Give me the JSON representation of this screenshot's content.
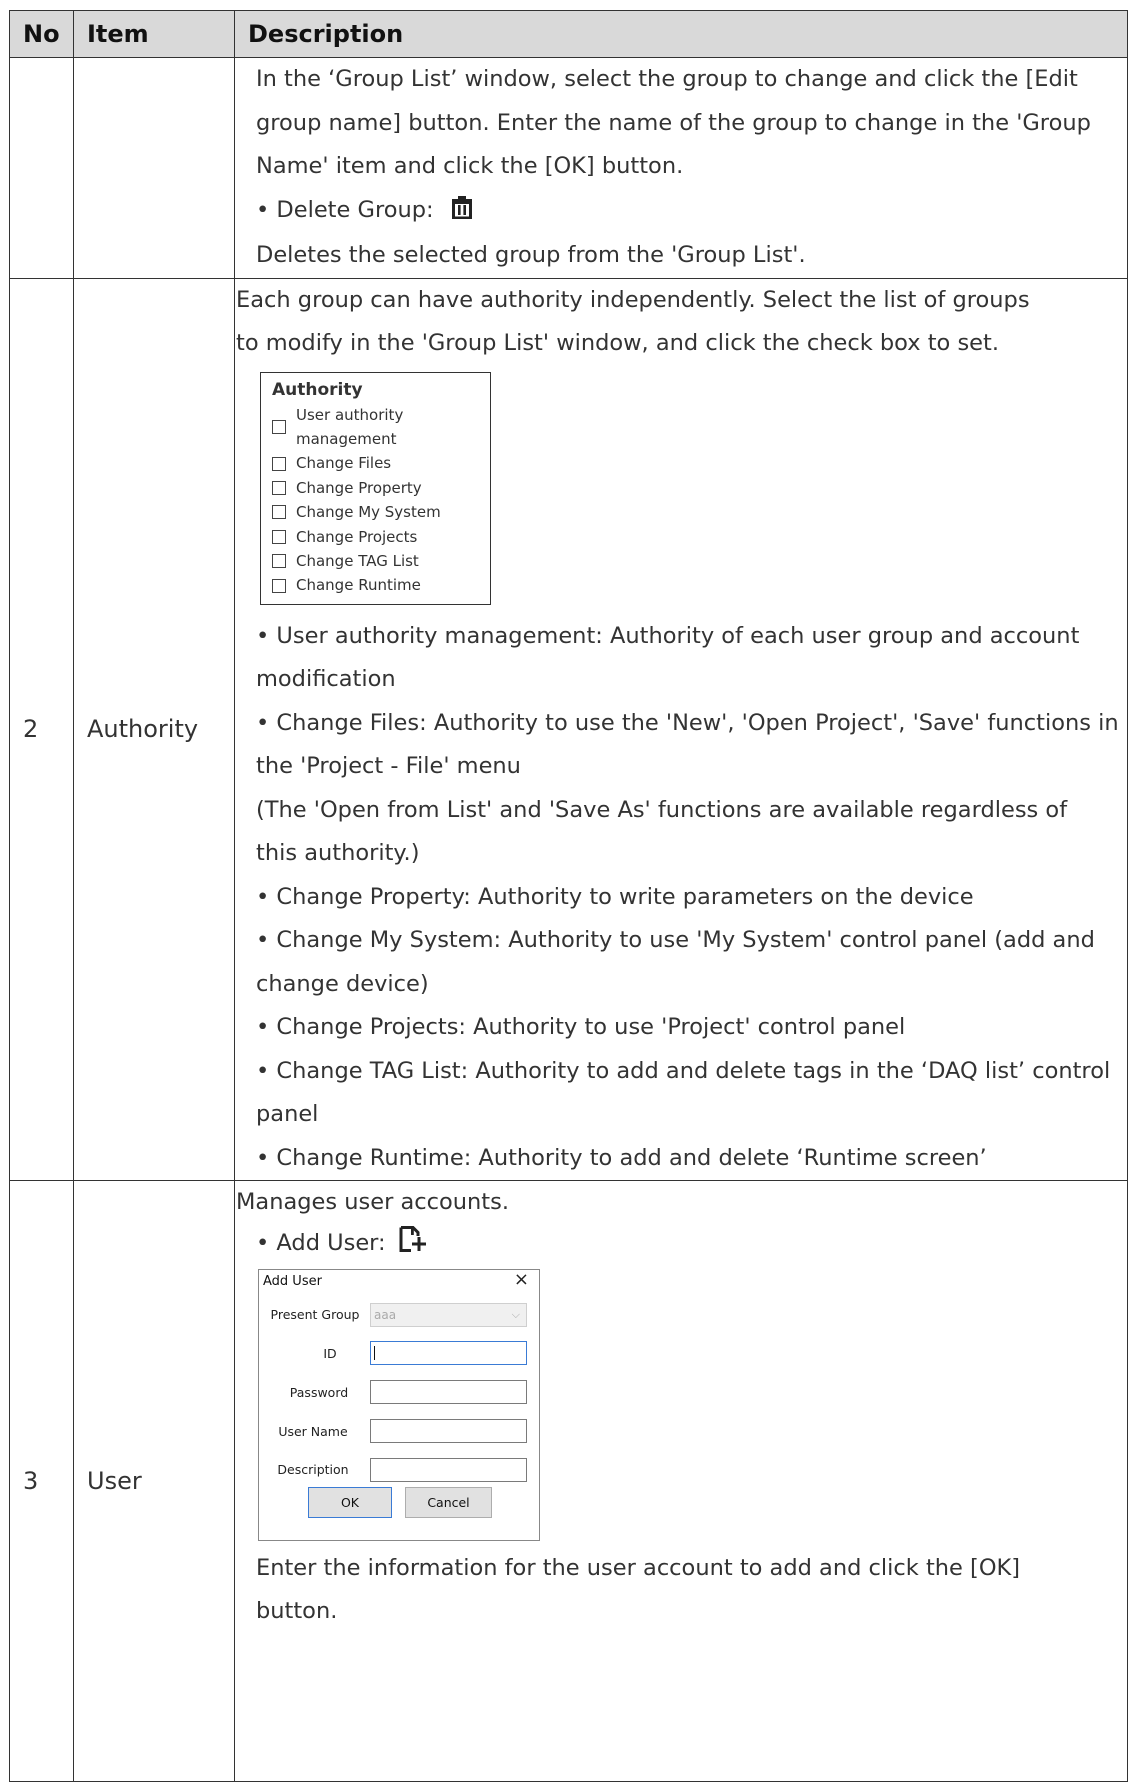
{
  "table": {
    "headers": {
      "no": "No",
      "item": "Item",
      "description": "Description"
    }
  },
  "row1": {
    "no": "",
    "item": "",
    "lines": [
      "In the ‘Group List’ window, select the group to change and click the [Edit",
      "group name] button. Enter the name of the group to change in the 'Group",
      "Name' item and click the [OK] button."
    ],
    "delete_label": "• Delete Group:",
    "delete_icon": "trash-icon",
    "delete_desc": "Deletes the selected group from the 'Group List'."
  },
  "row2": {
    "no": "2",
    "item": "Authority",
    "intro": [
      "Each group can have authority independently. Select the list of groups",
      "to modify in the 'Group List' window, and click the check box to set."
    ],
    "authority_box": {
      "title": "Authority",
      "options": [
        "User authority management",
        "Change Files",
        "Change Property",
        "Change My System",
        "Change Projects",
        "Change TAG List",
        "Change Runtime"
      ]
    },
    "bullets": [
      "• User authority management: Authority of each user group and account",
      "modification",
      "• Change Files: Authority to use the 'New', 'Open Project', 'Save' functions in",
      "the 'Project - File' menu",
      "(The 'Open from List' and 'Save As' functions are available regardless of",
      "this authority.)",
      "• Change Property: Authority to write parameters on the device",
      "• Change My System: Authority to use 'My System' control panel (add and",
      "change device)",
      "• Change Projects: Authority to use 'Project' control panel",
      "• Change TAG List: Authority to add and delete tags in the ‘DAQ list’ control",
      "panel",
      "• Change Runtime: Authority to add and delete ‘Runtime screen’"
    ]
  },
  "row3": {
    "no": "3",
    "item": "User",
    "intro": "Manages user accounts.",
    "add_label": "• Add User:",
    "add_icon": "add-document-icon",
    "dialog": {
      "title": "Add User",
      "close": "×",
      "present_group_label": "Present Group",
      "present_group_value": "aaa",
      "id_label": "ID",
      "password_label": "Password",
      "user_name_label": "User Name",
      "description_label": "Description",
      "ok": "OK",
      "cancel": "Cancel"
    },
    "outro": [
      "Enter the information for the user account to add and click the [OK]",
      "button."
    ]
  }
}
